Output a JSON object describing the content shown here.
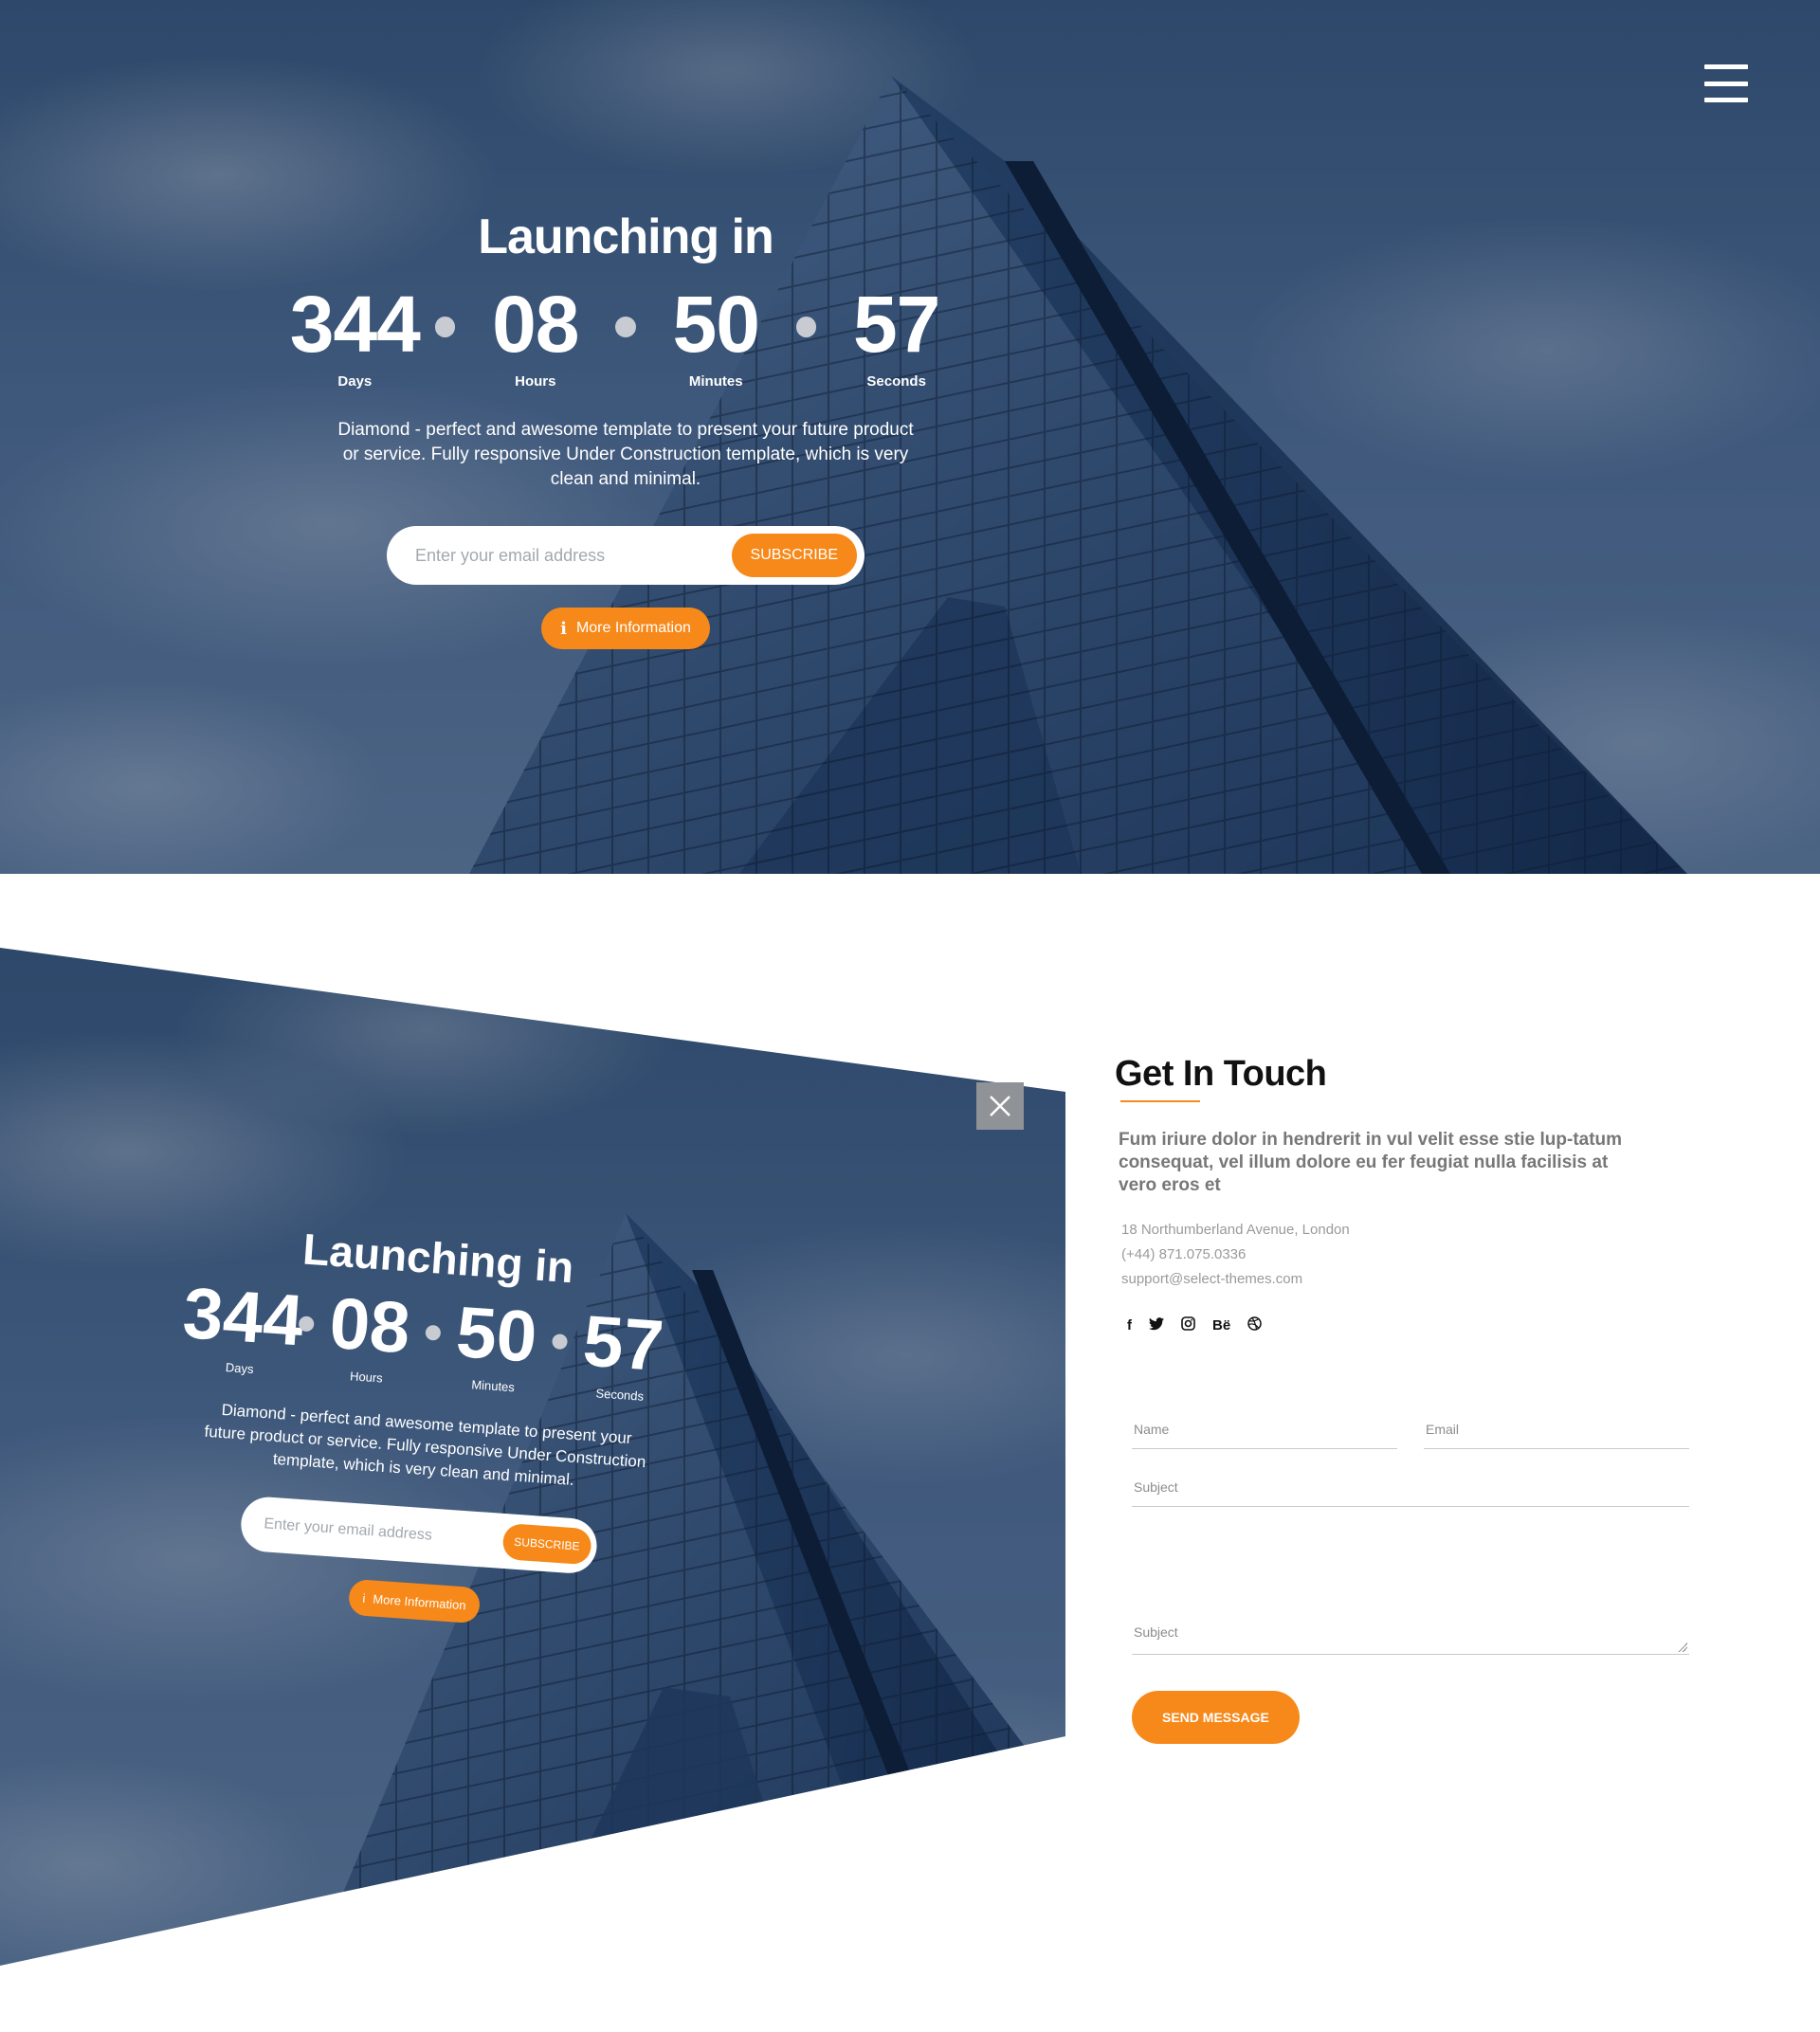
{
  "hero": {
    "title": "Launching in",
    "countdown": [
      {
        "value": "344",
        "label": "Days"
      },
      {
        "value": "08",
        "label": "Hours"
      },
      {
        "value": "50",
        "label": "Minutes"
      },
      {
        "value": "57",
        "label": "Seconds"
      }
    ],
    "description": "Diamond - perfect and awesome template to present your future product or service. Fully responsive Under Construction template, which is very clean and minimal.",
    "email_placeholder": "Enter your email address",
    "subscribe_label": "SUBSCRIBE",
    "more_info_label": "More Information"
  },
  "preview": {
    "title": "Launching in",
    "countdown": [
      {
        "value": "344",
        "label": "Days"
      },
      {
        "value": "08",
        "label": "Hours"
      },
      {
        "value": "50",
        "label": "Minutes"
      },
      {
        "value": "57",
        "label": "Seconds"
      }
    ],
    "description": "Diamond - perfect and awesome template to present your future product or service. Fully responsive Under Construction template, which is very clean and minimal.",
    "email_placeholder": "Enter your email address",
    "subscribe_label": "SUBSCRIBE",
    "more_info_label": "More Information"
  },
  "contact": {
    "title": "Get In Touch",
    "lead": "Fum iriure dolor in hendrerit in vul velit esse stie lup-tatum consequat, vel illum dolore eu fer feugiat nulla facilisis at vero eros et",
    "address": "18 Northumberland Avenue, London",
    "phone": "(+44) 871.075.0336",
    "email": "support@select-themes.com",
    "socials": [
      "f",
      "🐦",
      "◎",
      "Bë",
      "◎"
    ]
  },
  "form": {
    "name_placeholder": "Name",
    "email_placeholder": "Email",
    "subject_placeholder": "Subject",
    "message_placeholder": "Subject",
    "send_label": "SEND MESSAGE"
  },
  "colors": {
    "accent": "#f7891a",
    "sky": "#3d5b80",
    "close_bg": "#8f9296"
  },
  "icons": [
    "menu-icon",
    "info-icon",
    "close-icon",
    "facebook-icon",
    "twitter-icon",
    "instagram-icon",
    "behance-icon",
    "dribbble-icon"
  ]
}
